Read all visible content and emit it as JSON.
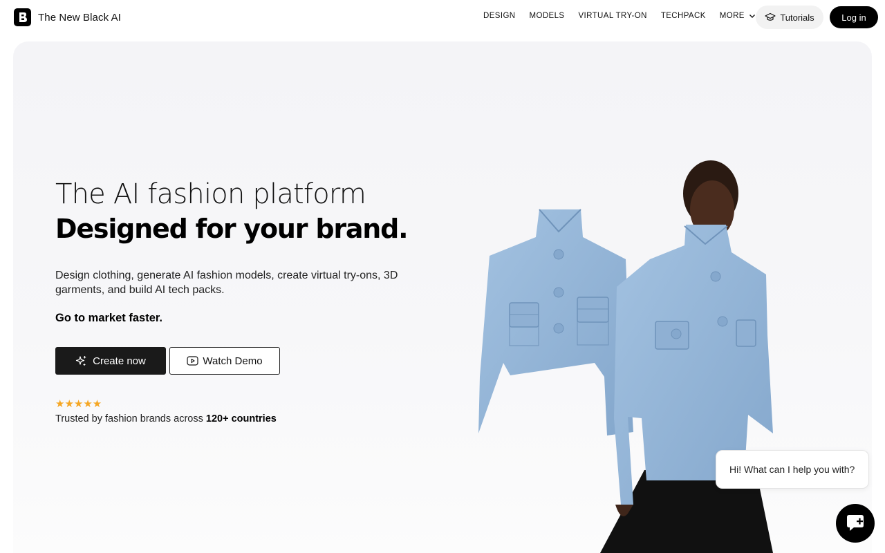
{
  "nav": {
    "brand_name": "The New Black AI",
    "menu": [
      "DESIGN",
      "MODELS",
      "VIRTUAL TRY-ON",
      "TECHPACK"
    ],
    "more_label": "MORE",
    "tutorials_label": "Tutorials",
    "login_label": "Log in"
  },
  "hero": {
    "title_line1": "The AI fashion platform",
    "title_line2": "Designed for your brand.",
    "subtitle": "Design clothing, generate AI fashion models, create virtual try-ons, 3D garments, and build AI tech packs.",
    "tagline": "Go to market faster.",
    "create_label": "Create now",
    "demo_label": "Watch Demo",
    "rating": "★★★★★",
    "trust_prefix": "Trusted by fashion brands across ",
    "trust_bold": "120+ countries"
  },
  "chat": {
    "greeting": "Hi! What can I help you with?"
  },
  "colors": {
    "accent": "#000000",
    "star": "#f5a623",
    "jacket": "#93b4d6",
    "hero_bg": "#f5f5f8"
  },
  "icons": [
    "logo-icon",
    "chevron-down-icon",
    "graduation-cap-icon",
    "sparkle-icon",
    "play-icon",
    "chat-icon"
  ]
}
